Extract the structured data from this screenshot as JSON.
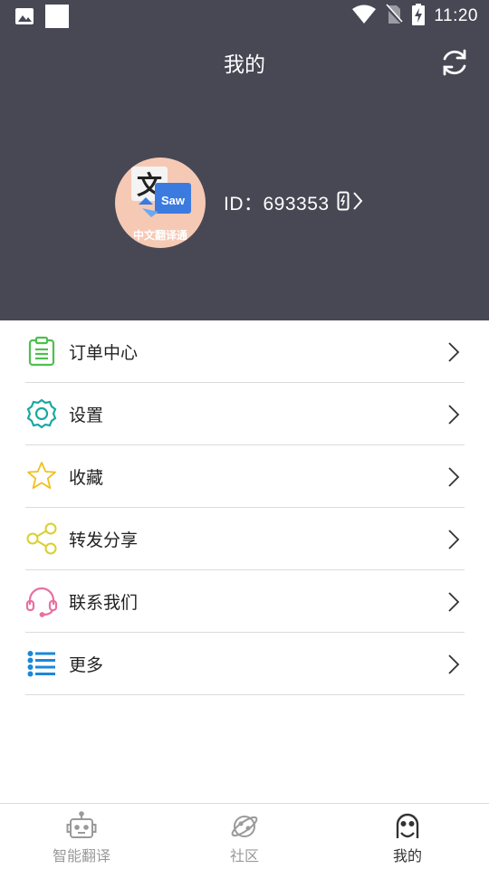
{
  "status_bar": {
    "time": "11:20",
    "icons": [
      "image-icon",
      "square-icon",
      "wifi-icon",
      "no-sim-icon",
      "battery-charging-icon"
    ]
  },
  "header": {
    "title": "我的",
    "refresh_icon": "refresh-icon"
  },
  "profile": {
    "avatar_text_main": "文",
    "avatar_text_badge": "Saw",
    "avatar_caption": "中文翻译通",
    "id_label": "ID：693353",
    "phone_icon": "phone-icon",
    "chevron_icon": "chevron-right-icon"
  },
  "menu": {
    "items": [
      {
        "label": "订单中心",
        "icon": "clipboard-icon",
        "color": "#4cc04c"
      },
      {
        "label": "设置",
        "icon": "gear-icon",
        "color": "#1aa8a0"
      },
      {
        "label": "收藏",
        "icon": "star-icon",
        "color": "#f0c020"
      },
      {
        "label": "转发分享",
        "icon": "share-icon",
        "color": "#d8d030"
      },
      {
        "label": "联系我们",
        "icon": "headset-icon",
        "color": "#e870a0"
      },
      {
        "label": "更多",
        "icon": "list-icon",
        "color": "#1a88d8"
      }
    ]
  },
  "bottom_nav": {
    "items": [
      {
        "label": "智能翻译",
        "icon": "robot-icon",
        "active": false
      },
      {
        "label": "社区",
        "icon": "planet-icon",
        "active": false
      },
      {
        "label": "我的",
        "icon": "face-icon",
        "active": true
      }
    ]
  },
  "colors": {
    "header_bg": "#474854",
    "divider": "#dcdcdc",
    "nav_inactive": "#9a9a9a",
    "nav_active": "#333333"
  }
}
